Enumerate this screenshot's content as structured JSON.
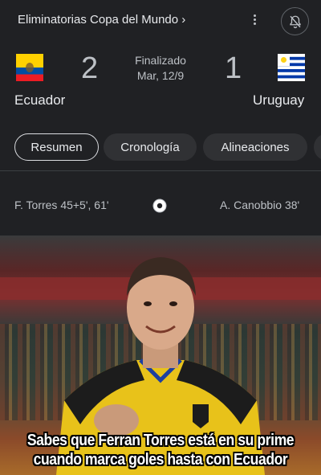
{
  "header": {
    "competition": "Eliminatorias Copa del Mundo ›"
  },
  "match": {
    "status": "Finalizado",
    "date": "Mar, 12/9",
    "home": {
      "name": "Ecuador",
      "score": "2",
      "flag_colors": [
        "#FFD100",
        "#034EA2",
        "#ED1C24"
      ]
    },
    "away": {
      "name": "Uruguay",
      "score": "1",
      "flag_colors": [
        "#FFFFFF",
        "#0038A8",
        "#FCD116"
      ]
    }
  },
  "tabs": [
    {
      "label": "Resumen",
      "active": true
    },
    {
      "label": "Cronología",
      "active": false
    },
    {
      "label": "Alineaciones",
      "active": false
    }
  ],
  "scorers": {
    "home": "F. Torres 45+5', 61'",
    "away": "A. Canobbio 38'"
  },
  "meme": {
    "line1": "Sabes que Ferran Torres está en su prime",
    "line2": "cuando marca goles hasta con Ecuador"
  },
  "icons": {
    "more": "more-vert-icon",
    "bell": "bell-add-icon",
    "ball": "soccer-ball-icon"
  }
}
